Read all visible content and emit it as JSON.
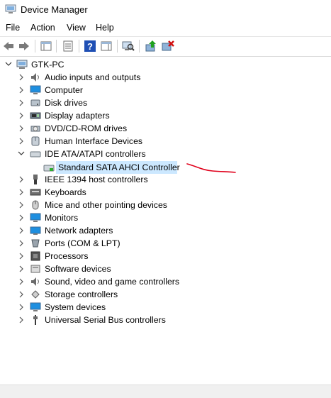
{
  "window": {
    "title": "Device Manager"
  },
  "menu": [
    "File",
    "Action",
    "View",
    "Help"
  ],
  "toolbar": {
    "buttons": [
      "back-icon",
      "forward-icon",
      "show-hide-console-tree-icon",
      "properties-icon",
      "help-icon",
      "show-action-pane-icon",
      "scan-hardware-icon",
      "update-driver-icon",
      "uninstall-device-icon"
    ]
  },
  "tree": {
    "root": "GTK-PC",
    "categories": [
      "Audio inputs and outputs",
      "Computer",
      "Disk drives",
      "Display adapters",
      "DVD/CD-ROM drives",
      "Human Interface Devices",
      "IDE ATA/ATAPI controllers",
      "IEEE 1394 host controllers",
      "Keyboards",
      "Mice and other pointing devices",
      "Monitors",
      "Network adapters",
      "Ports (COM & LPT)",
      "Processors",
      "Software devices",
      "Sound, video and game controllers",
      "Storage controllers",
      "System devices",
      "Universal Serial Bus controllers"
    ],
    "expanded_child": "Standard SATA AHCI Controller"
  },
  "colors": {
    "selection": "#cce8ff",
    "annotation": "#e0001b",
    "accent": "#1f6fd6"
  }
}
